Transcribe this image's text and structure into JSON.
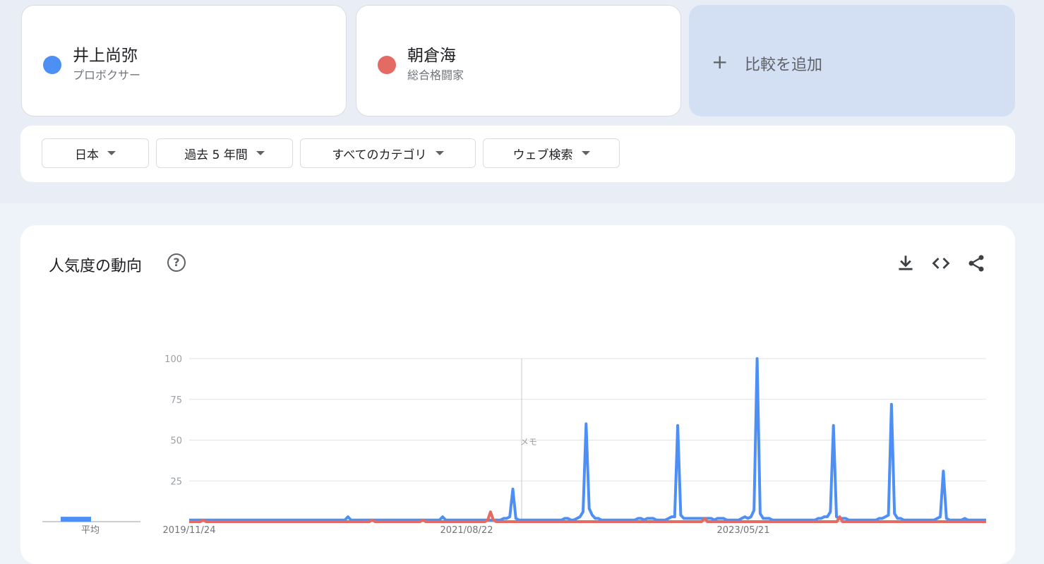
{
  "terms": [
    {
      "name": "井上尚弥",
      "subtitle": "プロボクサー",
      "color": "#4d8ff5"
    },
    {
      "name": "朝倉海",
      "subtitle": "総合格闘家",
      "color": "#e46b63"
    }
  ],
  "add_compare": {
    "plus": "+",
    "label": "比較を追加"
  },
  "filters": {
    "region": "日本",
    "time": "過去 5 年間",
    "category": "すべてのカテゴリ",
    "search_type": "ウェブ検索"
  },
  "panel": {
    "title": "人気度の動向",
    "help": "?",
    "icons": [
      "download-icon",
      "embed-code-icon",
      "share-icon"
    ]
  },
  "chart_data": {
    "type": "line",
    "yticks": [
      100,
      75,
      50,
      25
    ],
    "ylim": [
      0,
      100
    ],
    "xtick_labels": [
      "2019/11/24",
      "2021/08/22",
      "2023/05/21"
    ],
    "annotation": "メモ",
    "average_label": "平均",
    "averages": [
      {
        "series": "井上尚弥",
        "value": 3
      },
      {
        "series": "朝倉海",
        "value": 0
      }
    ],
    "series": [
      {
        "name": "井上尚弥",
        "color": "#4d8ff5",
        "values": [
          1,
          1,
          1,
          1,
          1,
          1,
          1,
          1,
          1,
          1,
          1,
          1,
          1,
          1,
          1,
          1,
          1,
          1,
          1,
          1,
          1,
          1,
          1,
          1,
          1,
          1,
          1,
          1,
          1,
          1,
          1,
          1,
          1,
          1,
          1,
          1,
          1,
          1,
          1,
          1,
          1,
          1,
          1,
          1,
          1,
          1,
          1,
          1,
          1,
          1,
          1,
          1,
          3,
          1,
          1,
          1,
          1,
          1,
          1,
          1,
          1,
          1,
          1,
          1,
          1,
          1,
          1,
          1,
          1,
          1,
          1,
          1,
          1,
          1,
          1,
          1,
          1,
          1,
          1,
          1,
          1,
          1,
          1,
          3,
          1,
          1,
          1,
          1,
          1,
          1,
          1,
          1,
          1,
          1,
          1,
          1,
          1,
          1,
          1,
          1,
          1,
          1,
          1,
          2,
          2,
          3,
          20,
          2,
          1,
          1,
          1,
          1,
          1,
          1,
          1,
          1,
          1,
          1,
          1,
          1,
          1,
          1,
          1,
          2,
          2,
          1,
          1,
          2,
          3,
          6,
          60,
          8,
          4,
          2,
          2,
          1,
          1,
          1,
          1,
          1,
          1,
          1,
          1,
          1,
          1,
          1,
          1,
          2,
          2,
          1,
          2,
          2,
          2,
          1,
          1,
          1,
          1,
          2,
          3,
          3,
          59,
          4,
          2,
          2,
          2,
          2,
          2,
          2,
          2,
          2,
          2,
          2,
          1,
          2,
          2,
          2,
          1,
          1,
          1,
          1,
          1,
          2,
          3,
          2,
          3,
          7,
          100,
          5,
          2,
          2,
          2,
          1,
          1,
          1,
          1,
          1,
          1,
          1,
          1,
          1,
          1,
          1,
          1,
          1,
          1,
          1,
          2,
          2,
          3,
          3,
          6,
          59,
          3,
          2,
          2,
          2,
          1,
          1,
          1,
          1,
          1,
          1,
          1,
          1,
          1,
          1,
          2,
          2,
          3,
          4,
          72,
          5,
          2,
          2,
          1,
          1,
          1,
          1,
          1,
          1,
          1,
          1,
          1,
          1,
          1,
          2,
          3,
          31,
          2,
          1,
          1,
          1,
          1,
          1,
          2,
          1,
          1,
          1,
          1,
          1,
          1,
          1
        ]
      },
      {
        "name": "朝倉海",
        "color": "#e46b63",
        "values": [
          0,
          0,
          0,
          0,
          0,
          1,
          0,
          0,
          0,
          0,
          0,
          0,
          0,
          0,
          0,
          0,
          0,
          0,
          0,
          0,
          0,
          0,
          0,
          0,
          0,
          0,
          0,
          0,
          0,
          0,
          0,
          0,
          0,
          0,
          0,
          0,
          0,
          0,
          0,
          0,
          0,
          0,
          0,
          0,
          0,
          0,
          0,
          0,
          0,
          0,
          0,
          0,
          0,
          0,
          0,
          0,
          0,
          0,
          0,
          0,
          0,
          0,
          0,
          0,
          0,
          1,
          0,
          0,
          0,
          0,
          0,
          0,
          0,
          0,
          0,
          0,
          0,
          0,
          0,
          0,
          0,
          0,
          0,
          1,
          0,
          0,
          0,
          0,
          0,
          0,
          0,
          0,
          0,
          0,
          0,
          0,
          0,
          0,
          0,
          0,
          0,
          0,
          0,
          0,
          0,
          0,
          1,
          6,
          1,
          0,
          0,
          0,
          0,
          0,
          0,
          0,
          0,
          0,
          0,
          0,
          0,
          0,
          0,
          0,
          0,
          0,
          0,
          0,
          0,
          0,
          0,
          0,
          0,
          0,
          0,
          0,
          0,
          0,
          0,
          0,
          0,
          0,
          0,
          0,
          0,
          0,
          0,
          0,
          0,
          0,
          0,
          0,
          0,
          0,
          0,
          0,
          0,
          0,
          0,
          0,
          0,
          0,
          0,
          0,
          0,
          0,
          0,
          0,
          0,
          0,
          0,
          0,
          0,
          0,
          0,
          0,
          0,
          0,
          0,
          0,
          0,
          0,
          0,
          2,
          0,
          0,
          0,
          0,
          0,
          0,
          0,
          0,
          0,
          0,
          0,
          0,
          0,
          0,
          0,
          0,
          0,
          0,
          0,
          0,
          0,
          0,
          0,
          0,
          0,
          0,
          0,
          0,
          0,
          0,
          0,
          0,
          0,
          0,
          0,
          0,
          0,
          0,
          0,
          0,
          0,
          0,
          0,
          0,
          0,
          0,
          0,
          3,
          0,
          0,
          0,
          0,
          0,
          0,
          0,
          0,
          0,
          0,
          0,
          0,
          0,
          0,
          0,
          0,
          0,
          0,
          0,
          0,
          0,
          0,
          0,
          0,
          0,
          0,
          0,
          0,
          0,
          0,
          0,
          0,
          0,
          0,
          0,
          0,
          0,
          0,
          0,
          0,
          0,
          0,
          0,
          0,
          0,
          0,
          0,
          0,
          0,
          0,
          0,
          0
        ]
      }
    ]
  }
}
